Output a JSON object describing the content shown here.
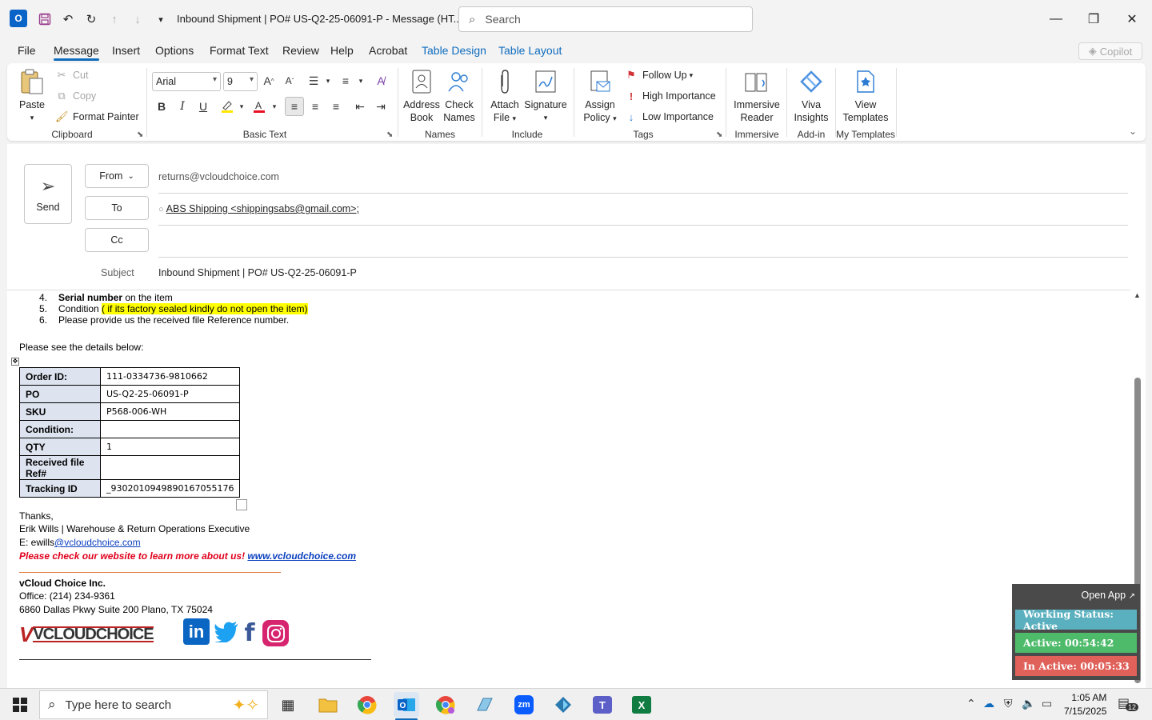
{
  "window": {
    "title": "Inbound Shipment | PO# US-Q2-25-06091-P  -  Message (HT...",
    "search_placeholder": "Search"
  },
  "menu": {
    "tabs": [
      "File",
      "Message",
      "Insert",
      "Options",
      "Format Text",
      "Review",
      "Help",
      "Acrobat",
      "Table Design",
      "Table Layout"
    ],
    "copilot": "Copilot"
  },
  "ribbon": {
    "clipboard": {
      "paste": "Paste",
      "cut": "Cut",
      "copy": "Copy",
      "format_painter": "Format Painter",
      "label": "Clipboard"
    },
    "basic_text": {
      "font": "Arial",
      "size": "9",
      "label": "Basic Text"
    },
    "names": {
      "address_book_1": "Address",
      "address_book_2": "Book",
      "check_names_1": "Check",
      "check_names_2": "Names",
      "label": "Names"
    },
    "include": {
      "attach_1": "Attach",
      "attach_2": "File",
      "signature": "Signature",
      "label": "Include"
    },
    "tags": {
      "assign_1": "Assign",
      "assign_2": "Policy",
      "follow_up": "Follow Up",
      "high": "High Importance",
      "low": "Low Importance",
      "label": "Tags"
    },
    "immersive": {
      "btn_1": "Immersive",
      "btn_2": "Reader",
      "label": "Immersive"
    },
    "addin": {
      "btn_1": "Viva",
      "btn_2": "Insights",
      "label": "Add-in"
    },
    "templates": {
      "btn_1": "View",
      "btn_2": "Templates",
      "label": "My Templates"
    }
  },
  "compose": {
    "send": "Send",
    "from_btn": "From",
    "from_value": "returns@vcloudchoice.com",
    "to_btn": "To",
    "to_value": "ABS Shipping <shippingsabs@gmail.com>;",
    "cc_btn": "Cc",
    "subject_label": "Subject",
    "subject_value": "Inbound Shipment | PO# US-Q2-25-06091-P"
  },
  "body": {
    "list": [
      {
        "num": "4.",
        "bold": "Serial number",
        "rest": " on the item"
      },
      {
        "num": "5.",
        "text": "Condition ",
        "highlight": "( if its factory sealed kindly do not open the item)"
      },
      {
        "num": "6.",
        "text": "Please provide us the received file Reference number."
      }
    ],
    "details_intro": "Please see the details below:",
    "table": [
      {
        "key": "Order ID:",
        "value": "111-0334736-9810662"
      },
      {
        "key": "PO",
        "value": "US-Q2-25-06091-P"
      },
      {
        "key": "SKU",
        "value": "P568-006-WH"
      },
      {
        "key": "Condition:",
        "value": ""
      },
      {
        "key": "QTY",
        "value": "1"
      },
      {
        "key": "Received file Ref#",
        "value": ""
      },
      {
        "key": "Tracking ID",
        "value": "_9302010949890167055176"
      }
    ],
    "thanks": "Thanks,",
    "sig_name": "Erik Wills | Warehouse & Return Operations Executive",
    "sig_email_prefix": "E: ewills",
    "sig_email_link": "@vcloudchoice.com",
    "website_text": "Please check our website to learn more about us! ",
    "website_link": "www.vcloudchoice.com",
    "company": "vCloud Choice Inc.",
    "office": "Office: (214) 234-9361",
    "address": "6860 Dallas Pkwy Suite 200 Plano, TX 75024",
    "logo_text": "VCLOUDCHOICE"
  },
  "widget": {
    "open_app": "Open App",
    "status": "Working Status: Active",
    "active": "Active: 00:54:42",
    "inactive": "In Active: 00:05:33",
    "colors": {
      "status": "#5ab0be",
      "active": "#4dbb6a",
      "inactive": "#e0605a"
    }
  },
  "taskbar": {
    "search_placeholder": "Type here to search",
    "time": "1:05 AM",
    "date": "7/15/2025",
    "notif_count": "12"
  }
}
